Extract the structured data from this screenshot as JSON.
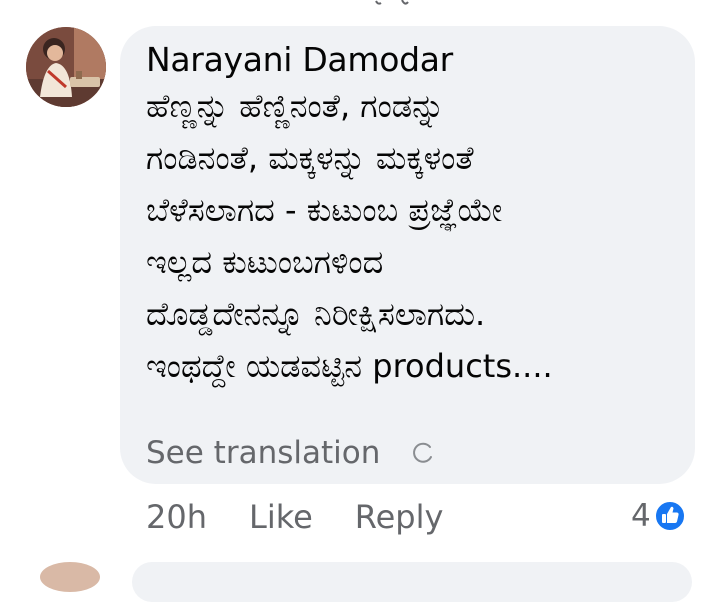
{
  "comment": {
    "author": "Narayani Damodar",
    "lines": [
      "ಹೆಣ್ಣನ್ನು ಹೆಣ್ಣಿನಂತೆ, ಗಂಡನ್ನು",
      "ಗಂಡಿನಂತೆ, ಮಕ್ಕಳನ್ನು ಮಕ್ಕಳಂತೆ",
      "ಬೆಳೆಸಲಾಗದ - ಕುಟುಂಬ ಪ್ರಜ್ಞೆಯೇ",
      "ಇಲ್ಲದ ಕುಟುಂಬಗಳಿಂದ",
      "ದೊಡ್ಡದೇನನ್ನೂ ನಿರೀಕ್ಷಿಸಲಾಗದು.",
      "ಇಂಥದ್ದೇ ಯಡವಟ್ಟಿನ products...."
    ],
    "see_translation": "See translation",
    "timestamp": "20h",
    "like_label": "Like",
    "reply_label": "Reply",
    "reaction_count": "4",
    "reaction_icon": "like-thumb-icon",
    "colors": {
      "bubble": "#f0f2f5",
      "text": "#050505",
      "secondary": "#65676b",
      "like_blue": "#1877f2"
    }
  }
}
